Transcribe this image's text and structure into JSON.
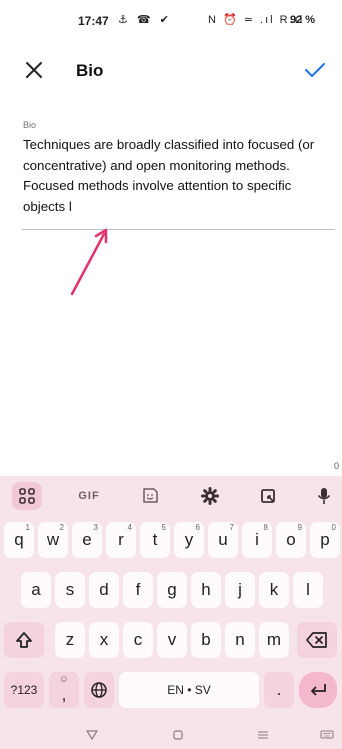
{
  "status_bar": {
    "time": "17:47",
    "left_icons": "⚓ ☎ ✔",
    "right_icons": "N ⏰ ≃ .ıl R.ıl",
    "battery": "92 %"
  },
  "app_bar": {
    "title": "Bio"
  },
  "bio_field": {
    "label": "Bio",
    "value": "Techniques are broadly classified into focused (or concentrative) and open monitoring methods. Focused methods involve attention to specific objects l"
  },
  "char_counter": "0",
  "keyboard": {
    "toolbar": {
      "gif_label": "GIF"
    },
    "row1": [
      {
        "key": "q",
        "hint": "1"
      },
      {
        "key": "w",
        "hint": "2"
      },
      {
        "key": "e",
        "hint": "3"
      },
      {
        "key": "r",
        "hint": "4"
      },
      {
        "key": "t",
        "hint": "5"
      },
      {
        "key": "y",
        "hint": "6"
      },
      {
        "key": "u",
        "hint": "7"
      },
      {
        "key": "i",
        "hint": "8"
      },
      {
        "key": "o",
        "hint": "9"
      },
      {
        "key": "p",
        "hint": "0"
      }
    ],
    "row2": [
      "a",
      "s",
      "d",
      "f",
      "g",
      "h",
      "j",
      "k",
      "l"
    ],
    "row3": [
      "z",
      "x",
      "c",
      "v",
      "b",
      "n",
      "m"
    ],
    "symbols_key": "?123",
    "emoji_comma": {
      "key": ",",
      "hint": "☺"
    },
    "space_label": "EN • SV",
    "period_key": "."
  },
  "colors": {
    "accent": "#1a73e8",
    "arrow": "#e0336b",
    "keyboard_bg": "#f6e4ea"
  }
}
